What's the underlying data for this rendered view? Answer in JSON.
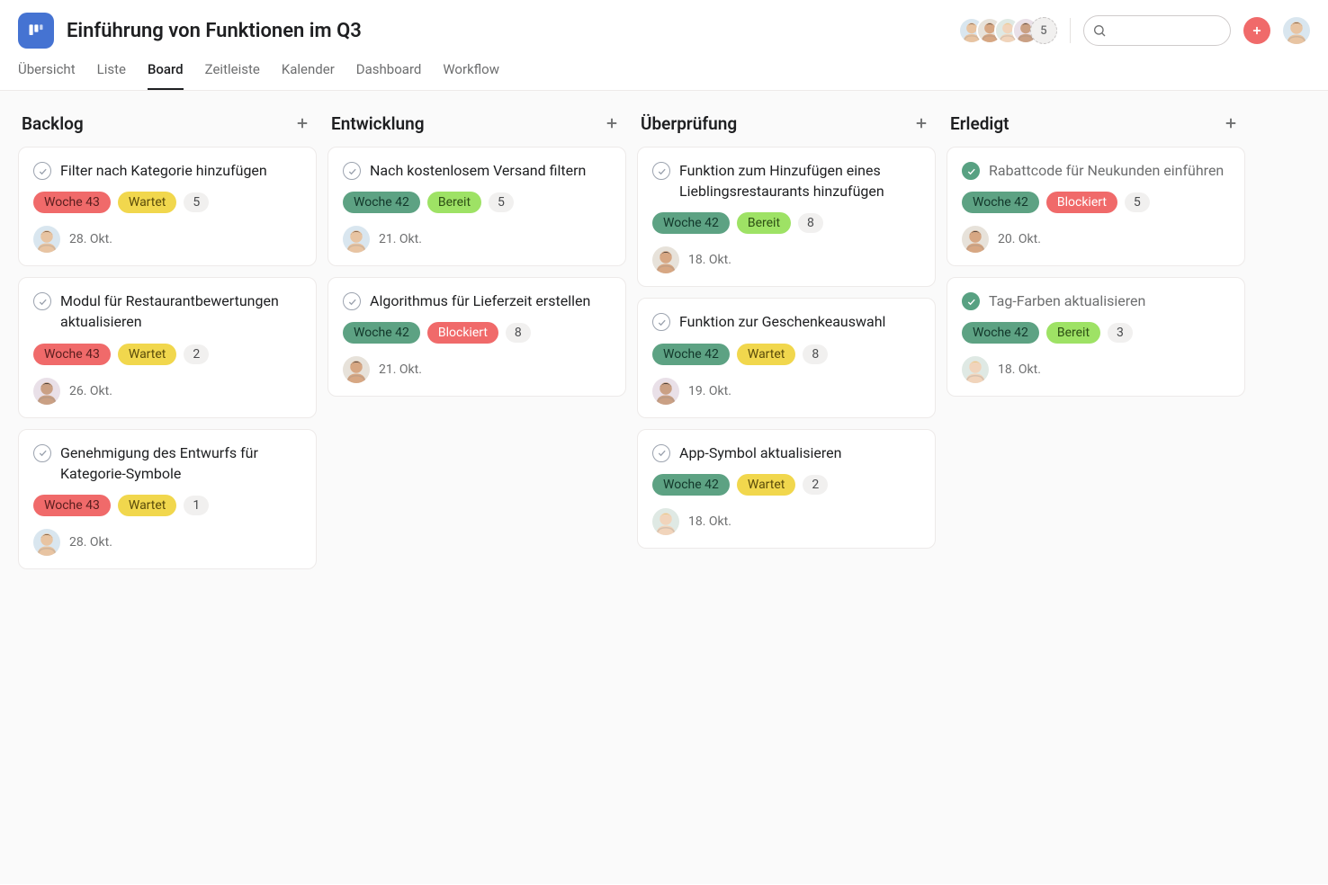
{
  "project": {
    "title": "Einführung von Funktionen im Q3"
  },
  "header": {
    "avatar_overflow": "5",
    "search_placeholder": ""
  },
  "tabs": [
    {
      "label": "Übersicht"
    },
    {
      "label": "Liste"
    },
    {
      "label": "Board"
    },
    {
      "label": "Zeitleiste"
    },
    {
      "label": "Kalender"
    },
    {
      "label": "Dashboard"
    },
    {
      "label": "Workflow"
    }
  ],
  "tag_styles": {
    "Woche 43": "red",
    "Woche 42": "teal",
    "Wartet": "yellow",
    "Bereit": "green",
    "Blockiert": "redbg"
  },
  "columns": [
    {
      "title": "Backlog",
      "cards": [
        {
          "title": "Filter nach Kategorie hinzufügen",
          "done": false,
          "tags": [
            "Woche 43",
            "Wartet"
          ],
          "count": "5",
          "date": "28. Okt.",
          "avatar": "a1"
        },
        {
          "title": "Modul für Restaurantbewertungen aktualisieren",
          "done": false,
          "tags": [
            "Woche 43",
            "Wartet"
          ],
          "count": "2",
          "date": "26. Okt.",
          "avatar": "a4"
        },
        {
          "title": "Genehmigung des Entwurfs für Kategorie-Symbole",
          "done": false,
          "tags": [
            "Woche 43",
            "Wartet"
          ],
          "count": "1",
          "date": "28. Okt.",
          "avatar": "a1"
        }
      ]
    },
    {
      "title": "Entwicklung",
      "cards": [
        {
          "title": "Nach kostenlosem Versand filtern",
          "done": false,
          "tags": [
            "Woche 42",
            "Bereit"
          ],
          "count": "5",
          "date": "21. Okt.",
          "avatar": "a1"
        },
        {
          "title": "Algorithmus für Lieferzeit erstellen",
          "done": false,
          "tags": [
            "Woche 42",
            "Blockiert"
          ],
          "count": "8",
          "date": "21. Okt.",
          "avatar": "a2"
        }
      ]
    },
    {
      "title": "Überprüfung",
      "cards": [
        {
          "title": "Funktion zum Hinzufügen eines Lieblingsrestaurants hinzufügen",
          "done": false,
          "tags": [
            "Woche 42",
            "Bereit"
          ],
          "count": "8",
          "date": "18. Okt.",
          "avatar": "a2"
        },
        {
          "title": "Funktion zur Geschenkeauswahl",
          "done": false,
          "tags": [
            "Woche 42",
            "Wartet"
          ],
          "count": "8",
          "date": "19. Okt.",
          "avatar": "a4"
        },
        {
          "title": "App-Symbol aktualisieren",
          "done": false,
          "tags": [
            "Woche 42",
            "Wartet"
          ],
          "count": "2",
          "date": "18. Okt.",
          "avatar": "a3"
        }
      ]
    },
    {
      "title": "Erledigt",
      "cards": [
        {
          "title": "Rabattcode für Neukunden einführen",
          "done": true,
          "tags": [
            "Woche 42",
            "Blockiert"
          ],
          "count": "5",
          "date": "20. Okt.",
          "avatar": "a2"
        },
        {
          "title": "Tag-Farben aktualisieren",
          "done": true,
          "tags": [
            "Woche 42",
            "Bereit"
          ],
          "count": "3",
          "date": "18. Okt.",
          "avatar": "a3"
        }
      ]
    }
  ],
  "avatar_colors": {
    "a1": {
      "skin": "#e8c4a2",
      "hair": "#6b4a2e",
      "bg": "#d9e6ef"
    },
    "a2": {
      "skin": "#d7a783",
      "hair": "#2b2b2b",
      "bg": "#e7e2da"
    },
    "a3": {
      "skin": "#f1d4bb",
      "hair": "#e4c77a",
      "bg": "#dfe9e4"
    },
    "a4": {
      "skin": "#caa084",
      "hair": "#1e1e1e",
      "bg": "#e9e0e8"
    }
  }
}
